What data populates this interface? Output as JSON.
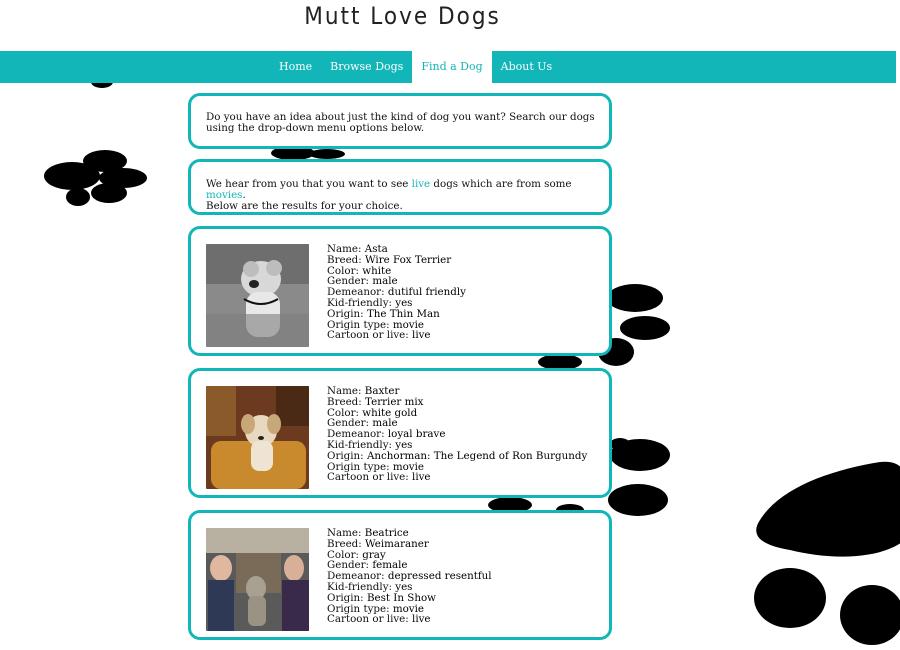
{
  "site": {
    "title": "Mutt Love Dogs"
  },
  "nav": {
    "items": [
      {
        "label": "Home",
        "active": false
      },
      {
        "label": "Browse Dogs",
        "active": false
      },
      {
        "label": "Find a Dog",
        "active": true
      },
      {
        "label": "About Us",
        "active": false
      }
    ]
  },
  "intro": {
    "text": "Do you have an idea about just the kind of dog you want? Search our dogs using the drop-down menu options below."
  },
  "summary": {
    "prefix": "We hear from you that you want to see ",
    "type_link": "live",
    "middle": " dogs which are from some ",
    "origin_link": "movies",
    "suffix": ".",
    "line2": "Below are the results for your choice."
  },
  "field_labels": {
    "name": "Name:",
    "breed": "Breed:",
    "color": "Color:",
    "gender": "Gender:",
    "demeanor": "Demeanor:",
    "kid_friendly": "Kid-friendly:",
    "origin": "Origin:",
    "origin_type": "Origin type:",
    "cartoon_or_live": "Cartoon or live:"
  },
  "dogs": [
    {
      "name": "Asta",
      "breed": "Wire Fox Terrier",
      "color": "white",
      "gender": "male",
      "demeanor": "dutiful friendly",
      "kid_friendly": "yes",
      "origin": "The Thin Man",
      "origin_type": "movie",
      "cartoon_or_live": "live"
    },
    {
      "name": "Baxter",
      "breed": "Terrier mix",
      "color": "white gold",
      "gender": "male",
      "demeanor": "loyal brave",
      "kid_friendly": "yes",
      "origin": "Anchorman: The Legend of Ron Burgundy",
      "origin_type": "movie",
      "cartoon_or_live": "live"
    },
    {
      "name": "Beatrice",
      "breed": "Weimaraner",
      "color": "gray",
      "gender": "female",
      "demeanor": "depressed resentful",
      "kid_friendly": "yes",
      "origin": "Best In Show",
      "origin_type": "movie",
      "cartoon_or_live": "live"
    }
  ],
  "colors": {
    "accent": "#12b6b8",
    "paw": "#000000"
  }
}
